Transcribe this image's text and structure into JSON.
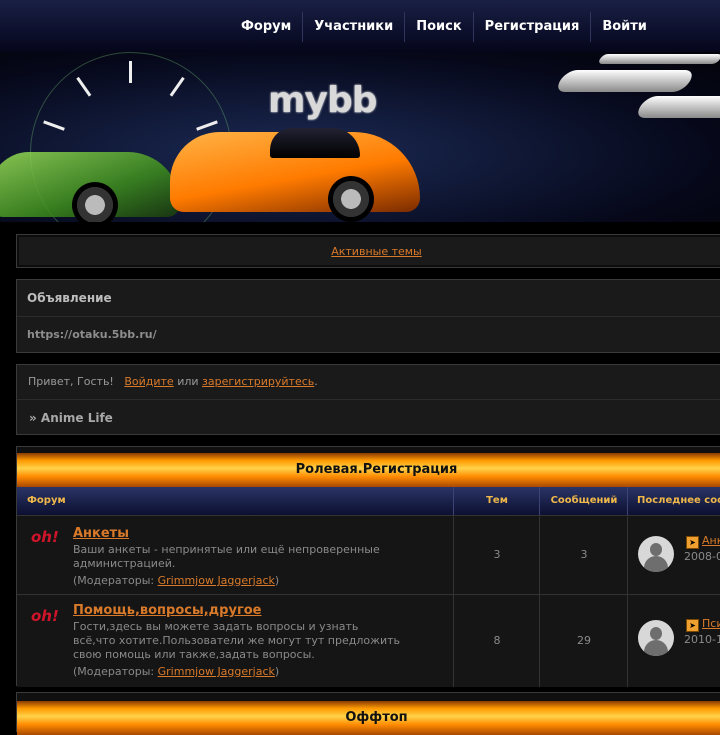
{
  "nav": {
    "items": [
      "Форум",
      "Участники",
      "Поиск",
      "Регистрация",
      "Войти"
    ]
  },
  "banner": {
    "logo_text": "mybb"
  },
  "active_topics": {
    "label": "Активные темы"
  },
  "announcement": {
    "title": "Объявление",
    "text": "https://otaku.5bb.ru/"
  },
  "welcome": {
    "greeting": "Привет, Гость!",
    "login_link": "Войдите",
    "or_text": "или",
    "register_link": "зарегистрируйтесь",
    "period": ".",
    "breadcrumb": "» Anime Life"
  },
  "category1": {
    "title": "Ролевая.Регистрация",
    "columns": {
      "forum": "Форум",
      "topics": "Тем",
      "posts": "Сообщений",
      "last_post": "Последнее сооб"
    },
    "forums": [
      {
        "icon_text": "oh!",
        "name": "Анкеты",
        "description": "Ваши анкеты - непринятые или ещё непроверенные администрацией.",
        "mod_prefix": "(Модераторы: ",
        "moderator": "Grimmjow Jaggerjack",
        "mod_suffix": ")",
        "topics": "3",
        "posts": "3",
        "last_link": "Анк",
        "last_date": "2008-0"
      },
      {
        "icon_text": "oh!",
        "name": "Помощь,вопросы,другое",
        "description": "Гости,здесь вы можете задать вопросы и узнать всё,что хотите.Пользователи же могут тут предложить свою помощь или также,задать вопросы.",
        "mod_prefix": "(Модераторы: ",
        "moderator": "Grimmjow Jaggerjack",
        "mod_suffix": ")",
        "topics": "8",
        "posts": "29",
        "last_link": "Пси",
        "last_date": "2010-1"
      }
    ]
  },
  "category2": {
    "title": "Оффтоп"
  },
  "colors": {
    "link": "#d97a2a",
    "header_text": "#f0b84a",
    "nav_bg": "#0b0e28",
    "category_gradient": "#ff9a00"
  }
}
